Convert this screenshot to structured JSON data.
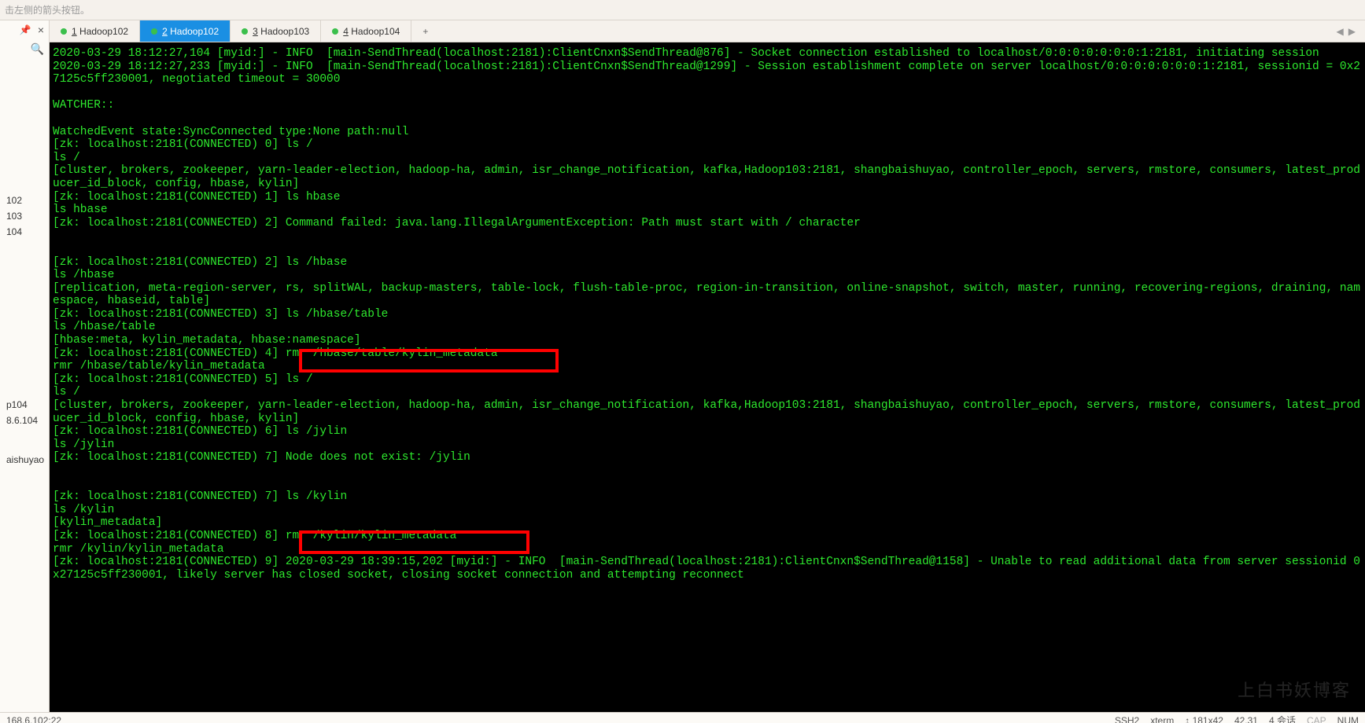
{
  "topHint": "击左侧的箭头按钮。",
  "sidebar": {
    "pinGlyph": "📌",
    "closeGlyph": "×",
    "searchGlyph": "🔍",
    "items1": [
      "102",
      "103",
      "104"
    ],
    "items2": [
      "p104",
      "8.6.104"
    ],
    "items3": [
      "aishuyao"
    ]
  },
  "tabs": [
    {
      "prefix": "1",
      "label": " Hadoop102",
      "active": false
    },
    {
      "prefix": "2",
      "label": " Hadoop102",
      "active": true
    },
    {
      "prefix": "3",
      "label": " Hadoop103",
      "active": false
    },
    {
      "prefix": "4",
      "label": " Hadoop104",
      "active": false
    }
  ],
  "tabAdd": "+",
  "tabNav": {
    "prev": "◀",
    "next": "▶"
  },
  "terminal": {
    "lines": [
      "2020-03-29 18:12:27,104 [myid:] - INFO  [main-SendThread(localhost:2181):ClientCnxn$SendThread@876] - Socket connection established to localhost/0:0:0:0:0:0:0:1:2181, initiating session",
      "2020-03-29 18:12:27,233 [myid:] - INFO  [main-SendThread(localhost:2181):ClientCnxn$SendThread@1299] - Session establishment complete on server localhost/0:0:0:0:0:0:0:1:2181, sessionid = 0x27125c5ff230001, negotiated timeout = 30000",
      "",
      "WATCHER::",
      "",
      "WatchedEvent state:SyncConnected type:None path:null",
      "[zk: localhost:2181(CONNECTED) 0] ls /",
      "ls /",
      "[cluster, brokers, zookeeper, yarn-leader-election, hadoop-ha, admin, isr_change_notification, kafka,Hadoop103:2181, shangbaishuyao, controller_epoch, servers, rmstore, consumers, latest_producer_id_block, config, hbase, kylin]",
      "[zk: localhost:2181(CONNECTED) 1] ls hbase",
      "ls hbase",
      "[zk: localhost:2181(CONNECTED) 2] Command failed: java.lang.IllegalArgumentException: Path must start with / character",
      "",
      "",
      "[zk: localhost:2181(CONNECTED) 2] ls /hbase",
      "ls /hbase",
      "[replication, meta-region-server, rs, splitWAL, backup-masters, table-lock, flush-table-proc, region-in-transition, online-snapshot, switch, master, running, recovering-regions, draining, namespace, hbaseid, table]",
      "[zk: localhost:2181(CONNECTED) 3] ls /hbase/table",
      "ls /hbase/table",
      "[hbase:meta, kylin_metadata, hbase:namespace]",
      "[zk: localhost:2181(CONNECTED) 4] rmr /hbase/table/kylin_metadata",
      "rmr /hbase/table/kylin_metadata",
      "[zk: localhost:2181(CONNECTED) 5] ls /",
      "ls /",
      "[cluster, brokers, zookeeper, yarn-leader-election, hadoop-ha, admin, isr_change_notification, kafka,Hadoop103:2181, shangbaishuyao, controller_epoch, servers, rmstore, consumers, latest_producer_id_block, config, hbase, kylin]",
      "[zk: localhost:2181(CONNECTED) 6] ls /jylin",
      "ls /jylin",
      "[zk: localhost:2181(CONNECTED) 7] Node does not exist: /jylin",
      "",
      "",
      "[zk: localhost:2181(CONNECTED) 7] ls /kylin",
      "ls /kylin",
      "[kylin_metadata]",
      "[zk: localhost:2181(CONNECTED) 8] rmr /kylin/kylin_metadata",
      "rmr /kylin/kylin_metadata",
      "[zk: localhost:2181(CONNECTED) 9] 2020-03-29 18:39:15,202 [myid:] - INFO  [main-SendThread(localhost:2181):ClientCnxn$SendThread@1158] - Unable to read additional data from server sessionid 0x27125c5ff230001, likely server has closed socket, closing socket connection and attempting reconnect"
    ]
  },
  "watermark": "上白书妖博客",
  "status": {
    "left": "168.6.102:22",
    "ssh": "SSH2",
    "term": "xterm",
    "size": "181x42",
    "cursor": "42,31",
    "sessions": "4 会话",
    "cap": "CAP",
    "num": "NUM"
  }
}
